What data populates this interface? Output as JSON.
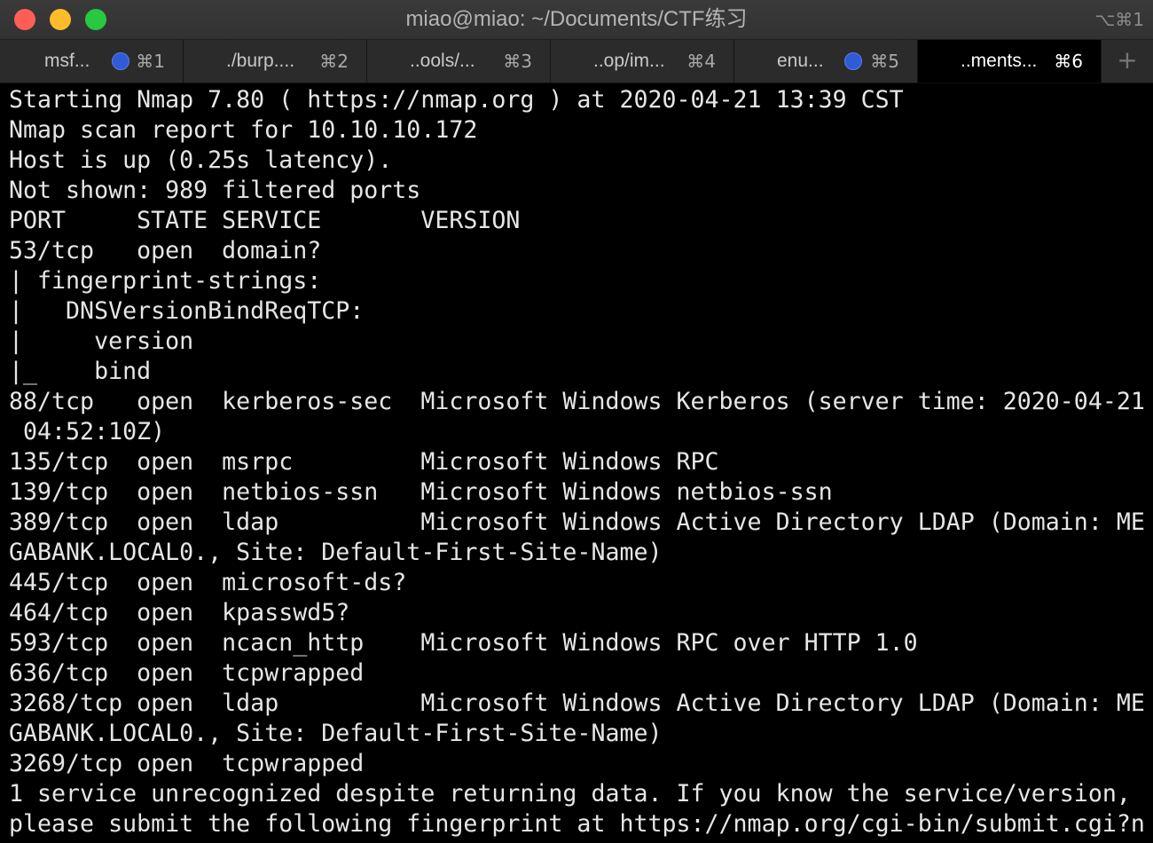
{
  "window": {
    "title": "miao@miao: ~/Documents/CTF练习",
    "shortcut": "⌥⌘1"
  },
  "tabs": [
    {
      "label": "msf...",
      "has_dot": true,
      "key": "⌘1",
      "active": false
    },
    {
      "label": "./burp....",
      "has_dot": false,
      "key": "⌘2",
      "active": false
    },
    {
      "label": "..ools/...",
      "has_dot": false,
      "key": "⌘3",
      "active": false
    },
    {
      "label": "..op/im...",
      "has_dot": false,
      "key": "⌘4",
      "active": false
    },
    {
      "label": "enu...",
      "has_dot": true,
      "key": "⌘5",
      "active": false
    },
    {
      "label": "..ments...",
      "has_dot": false,
      "key": "⌘6",
      "active": true
    }
  ],
  "new_tab_label": "+",
  "colors": {
    "activity_dot": "#2f5bd8",
    "close": "#fd5f57",
    "minimize": "#febb2d",
    "maximize": "#28c840"
  },
  "terminal": {
    "lines": [
      "Starting Nmap 7.80 ( https://nmap.org ) at 2020-04-21 13:39 CST",
      "Nmap scan report for 10.10.10.172",
      "Host is up (0.25s latency).",
      "Not shown: 989 filtered ports",
      "PORT     STATE SERVICE       VERSION",
      "53/tcp   open  domain?",
      "| fingerprint-strings:",
      "|   DNSVersionBindReqTCP:",
      "|     version",
      "|_    bind",
      "88/tcp   open  kerberos-sec  Microsoft Windows Kerberos (server time: 2020-04-21",
      " 04:52:10Z)",
      "135/tcp  open  msrpc         Microsoft Windows RPC",
      "139/tcp  open  netbios-ssn   Microsoft Windows netbios-ssn",
      "389/tcp  open  ldap          Microsoft Windows Active Directory LDAP (Domain: ME",
      "GABANK.LOCAL0., Site: Default-First-Site-Name)",
      "445/tcp  open  microsoft-ds?",
      "464/tcp  open  kpasswd5?",
      "593/tcp  open  ncacn_http    Microsoft Windows RPC over HTTP 1.0",
      "636/tcp  open  tcpwrapped",
      "3268/tcp open  ldap          Microsoft Windows Active Directory LDAP (Domain: ME",
      "GABANK.LOCAL0., Site: Default-First-Site-Name)",
      "3269/tcp open  tcpwrapped",
      "1 service unrecognized despite returning data. If you know the service/version,",
      "please submit the following fingerprint at https://nmap.org/cgi-bin/submit.cgi?n"
    ]
  }
}
